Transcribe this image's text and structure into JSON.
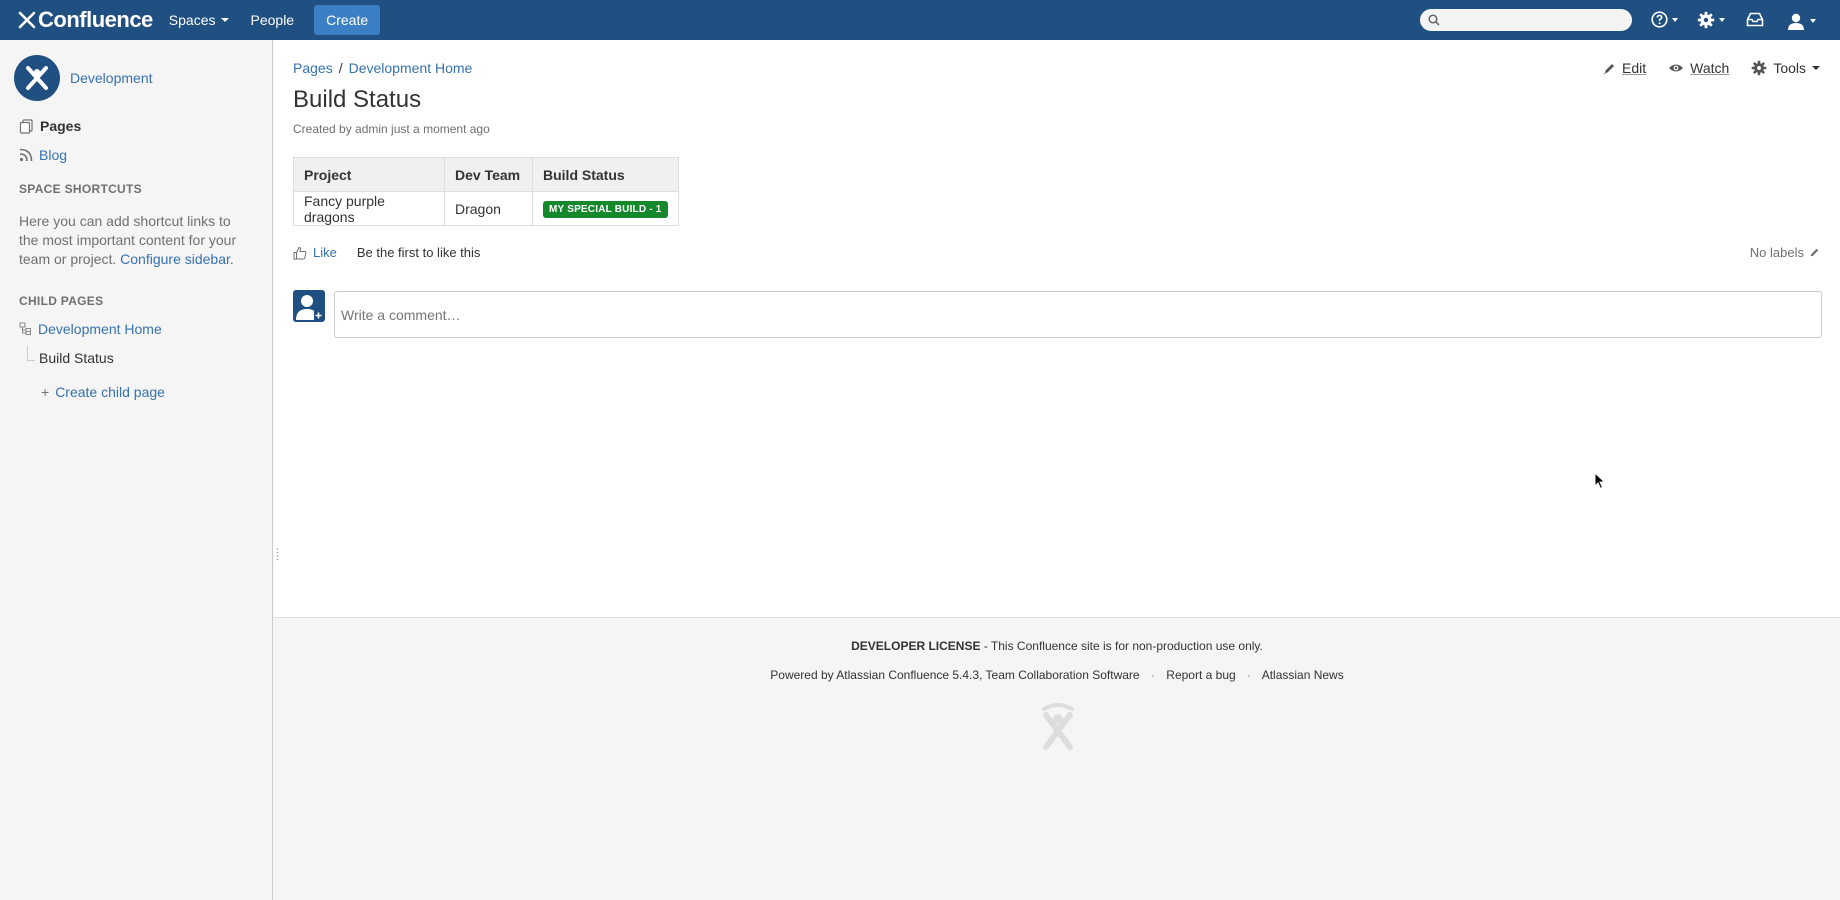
{
  "header": {
    "logo_text": "Confluence",
    "nav": {
      "spaces": "Spaces",
      "people": "People"
    },
    "create_label": "Create",
    "search": {
      "placeholder": ""
    }
  },
  "sidebar": {
    "space_name": "Development",
    "pages_label": "Pages",
    "blog_label": "Blog",
    "shortcuts_heading": "SPACE SHORTCUTS",
    "shortcuts_text": "Here you can add shortcut links to the most important content for your team or project.",
    "configure_link": "Configure sidebar.",
    "child_pages_heading": "CHILD PAGES",
    "child_pages": [
      {
        "label": "Development Home"
      },
      {
        "label": "Build Status"
      }
    ],
    "create_child": "Create child page"
  },
  "page": {
    "breadcrumb": [
      "Pages",
      "Development Home"
    ],
    "breadcrumb_sep": "/",
    "title": "Build Status",
    "byline": "Created by admin just a moment ago",
    "actions": {
      "edit": "Edit",
      "watch": "Watch",
      "tools": "Tools"
    },
    "table": {
      "headers": [
        "Project",
        "Dev Team",
        "Build Status"
      ],
      "rows": [
        [
          "Fancy purple dragons",
          "Dragon",
          "MY SPECIAL BUILD - 1"
        ]
      ]
    },
    "like_label": "Like",
    "like_text": "Be the first to like this",
    "labels_text": "No labels",
    "comment_placeholder": "Write a comment…"
  },
  "footer": {
    "license_bold": "DEVELOPER LICENSE",
    "license_text": " - This Confluence site is for non-production use only.",
    "powered_by": "Powered by Atlassian Confluence 5.4.3, Team Collaboration Software",
    "report_bug": "Report a bug",
    "news": "Atlassian News",
    "dot": "·"
  },
  "colors": {
    "header_bg": "#205081",
    "link": "#3572b0",
    "create_button": "#3b7fc4",
    "status_lozenge": "#14892c"
  }
}
